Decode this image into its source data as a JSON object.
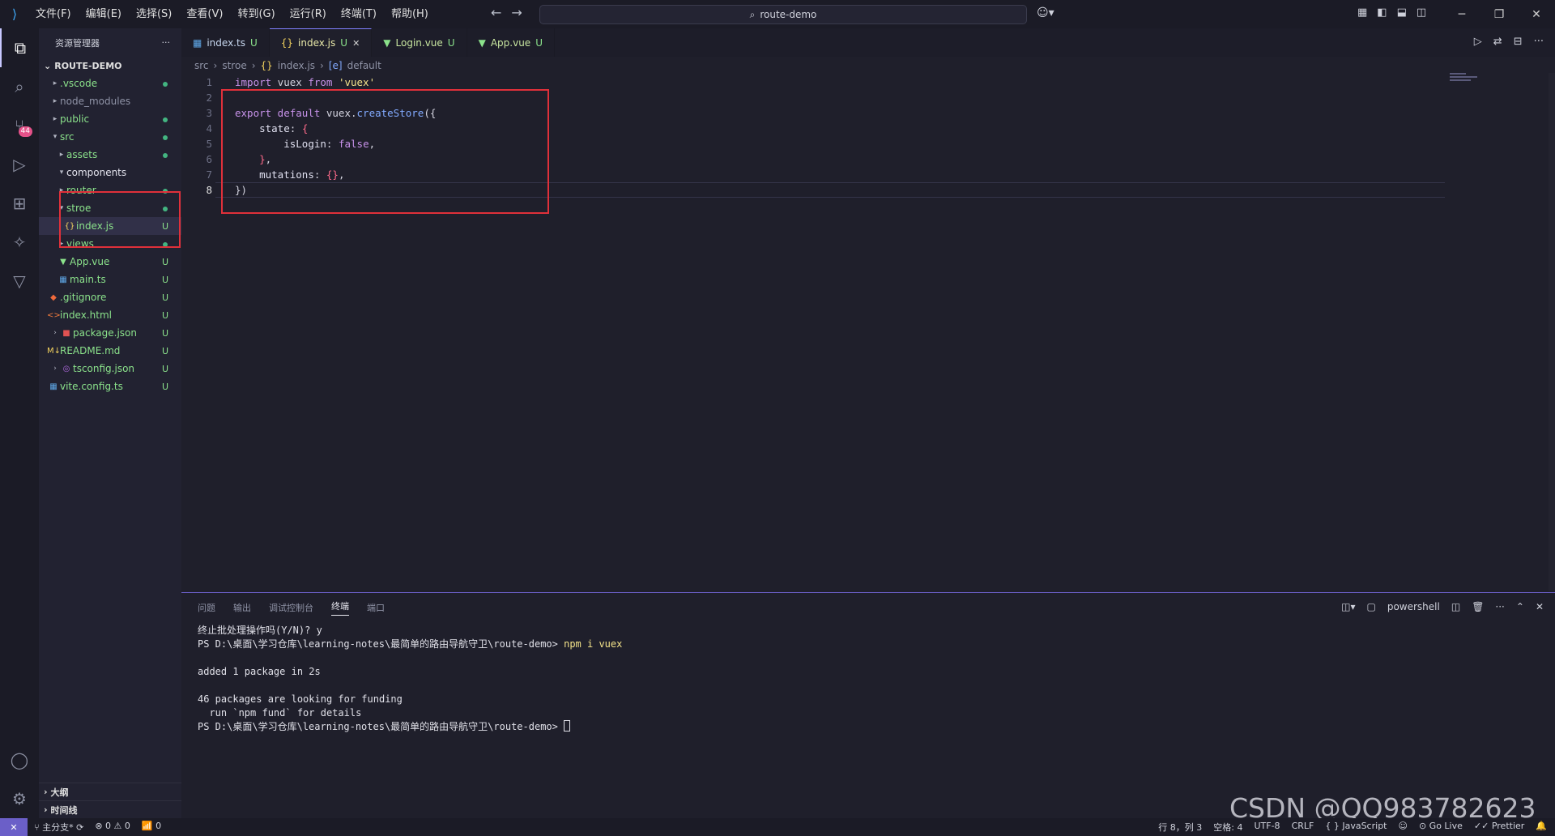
{
  "titlebar": {
    "menu": [
      "文件(F)",
      "编辑(E)",
      "选择(S)",
      "查看(V)",
      "转到(G)",
      "运行(R)",
      "终端(T)",
      "帮助(H)"
    ],
    "search": "route-demo"
  },
  "sidebar": {
    "title": "资源管理器",
    "project": "ROUTE-DEMO",
    "items": [
      {
        "name": ".vscode",
        "mark": "dot"
      },
      {
        "name": "node_modules",
        "mark": ""
      },
      {
        "name": "public",
        "mark": "dot"
      },
      {
        "name": "src",
        "mark": "dot"
      },
      {
        "name": "assets",
        "mark": "dot"
      },
      {
        "name": "components",
        "mark": ""
      },
      {
        "name": "router",
        "mark": "dot"
      },
      {
        "name": "stroe",
        "mark": "dot"
      },
      {
        "name": "index.js",
        "mark": "U"
      },
      {
        "name": "views",
        "mark": "dot"
      },
      {
        "name": "App.vue",
        "mark": "U"
      },
      {
        "name": "main.ts",
        "mark": "U"
      },
      {
        "name": ".gitignore",
        "mark": "U"
      },
      {
        "name": "index.html",
        "mark": "U"
      },
      {
        "name": "package.json",
        "mark": "U"
      },
      {
        "name": "README.md",
        "mark": "U"
      },
      {
        "name": "tsconfig.json",
        "mark": "U"
      },
      {
        "name": "vite.config.ts",
        "mark": "U"
      }
    ],
    "outline": "大纲",
    "timeline": "时间线"
  },
  "tabs": [
    {
      "label": "index.ts",
      "status": "U"
    },
    {
      "label": "index.js",
      "status": "U"
    },
    {
      "label": "Login.vue",
      "status": "U"
    },
    {
      "label": "App.vue",
      "status": "U"
    }
  ],
  "breadcrumb": [
    "src",
    "stroe",
    "index.js",
    "default"
  ],
  "code_lines": [
    "import vuex from 'vuex'",
    "",
    "export default vuex.createStore({",
    "    state: {",
    "        isLogin: false,",
    "    },",
    "    mutations: {},",
    "})"
  ],
  "panel": {
    "tabs": [
      "问题",
      "输出",
      "调试控制台",
      "终端",
      "端口"
    ],
    "shell": "powershell",
    "terminal": [
      "终止批处理操作吗(Y/N)? y",
      "PS D:\\桌面\\学习仓库\\learning-notes\\最简单的路由导航守卫\\route-demo> ",
      "",
      "added 1 package in 2s",
      "",
      "46 packages are looking for funding",
      "  run `npm fund` for details",
      "PS D:\\桌面\\学习仓库\\learning-notes\\最简单的路由导航守卫\\route-demo> "
    ],
    "command": "npm i vuex"
  },
  "statusbar": {
    "branch": "主分支*",
    "errors": "0",
    "warnings": "0",
    "ports": "0",
    "position": "行 8，列 3",
    "spaces": "空格: 4",
    "encoding": "UTF-8",
    "eol": "CRLF",
    "language": "JavaScript",
    "golive": "Go Live",
    "prettier": "Prettier"
  },
  "watermark": "CSDN @QQ983782623",
  "badge": "44"
}
